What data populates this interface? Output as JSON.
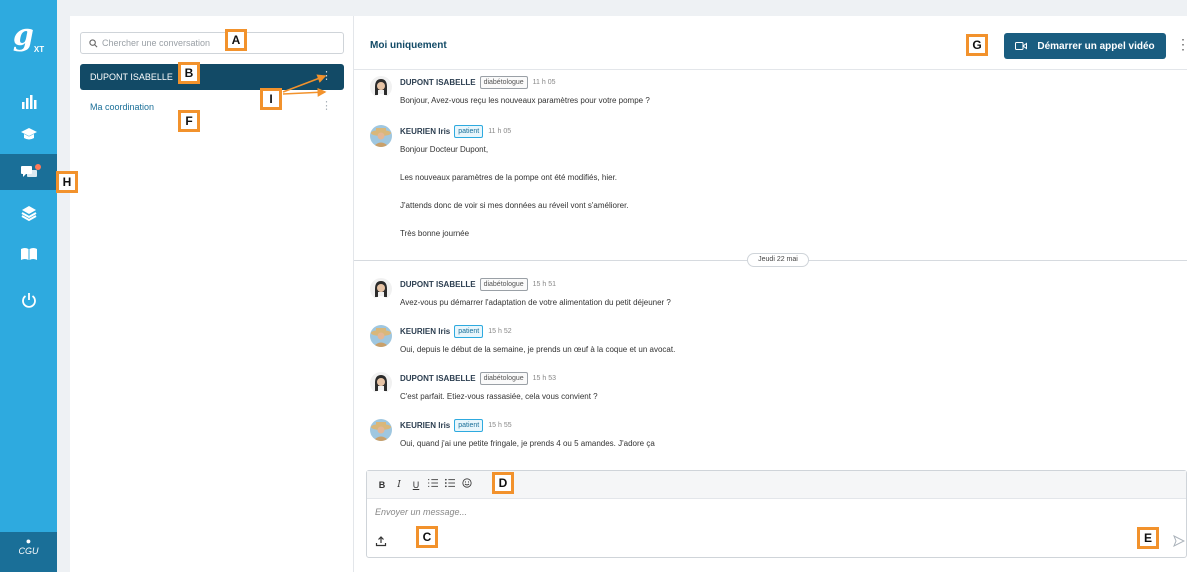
{
  "rail": {
    "logo": "g",
    "logo_sup": "XT",
    "nav": [
      {
        "icon": "bar-chart-icon"
      },
      {
        "icon": "graduation-cap-icon"
      },
      {
        "icon": "chat-icon",
        "active": true,
        "notification": true
      },
      {
        "icon": "layers-icon"
      },
      {
        "icon": "book-icon"
      },
      {
        "icon": "power-icon"
      }
    ],
    "footer_label": "CGU"
  },
  "conversations": {
    "search_placeholder": "Chercher une conversation",
    "items": [
      {
        "label": "DUPONT ISABELLE",
        "active": true
      },
      {
        "label": "Ma coordination",
        "active": false
      }
    ]
  },
  "chat": {
    "title": "Moi uniquement",
    "video_button": "Démarrer un appel vidéo",
    "date_separator": "Jeudi 22 mai",
    "messages": [
      {
        "author": "DUPONT ISABELLE",
        "role": "diabétologue",
        "time": "11 h 05",
        "lines": [
          "Bonjour, Avez-vous reçu les nouveaux paramètres pour votre pompe ?"
        ]
      },
      {
        "author": "KEURIEN Iris",
        "role": "patient",
        "time": "11 h 05",
        "lines": [
          "Bonjour Docteur Dupont,",
          "Les nouveaux paramètres de la pompe ont été modifiés, hier.",
          "J'attends donc de voir si mes données au réveil vont s'améliorer.",
          "Très bonne journée"
        ]
      },
      {
        "author": "DUPONT ISABELLE",
        "role": "diabétologue",
        "time": "15 h 51",
        "lines": [
          "Avez-vous pu démarrer l'adaptation de votre alimentation du petit déjeuner ?"
        ]
      },
      {
        "author": "KEURIEN Iris",
        "role": "patient",
        "time": "15 h 52",
        "lines": [
          "Oui, depuis le début de la semaine, je prends un œuf à la coque et un avocat."
        ]
      },
      {
        "author": "DUPONT ISABELLE",
        "role": "diabétologue",
        "time": "15 h 53",
        "lines": [
          "C'est parfait. Etiez-vous rassasiée, cela vous convient ?"
        ]
      },
      {
        "author": "KEURIEN Iris",
        "role": "patient",
        "time": "15 h 55",
        "lines": [
          "Oui, quand j'ai une petite fringale, je prends 4 ou 5 amandes. J'adore ça"
        ]
      }
    ],
    "composer": {
      "placeholder": "Envoyer un message...",
      "tools": {
        "bold": "B",
        "italic": "I",
        "underline": "U"
      }
    }
  },
  "annotations": {
    "A": "A",
    "B": "B",
    "C": "C",
    "D": "D",
    "E": "E",
    "F": "F",
    "G": "G",
    "H": "H",
    "I": "I",
    "color": "#f2922c"
  },
  "colors": {
    "rail": "#2eaadf",
    "rail_active": "#1a6f98",
    "conversation_active": "#124a66",
    "video_button": "#1a5d80"
  }
}
